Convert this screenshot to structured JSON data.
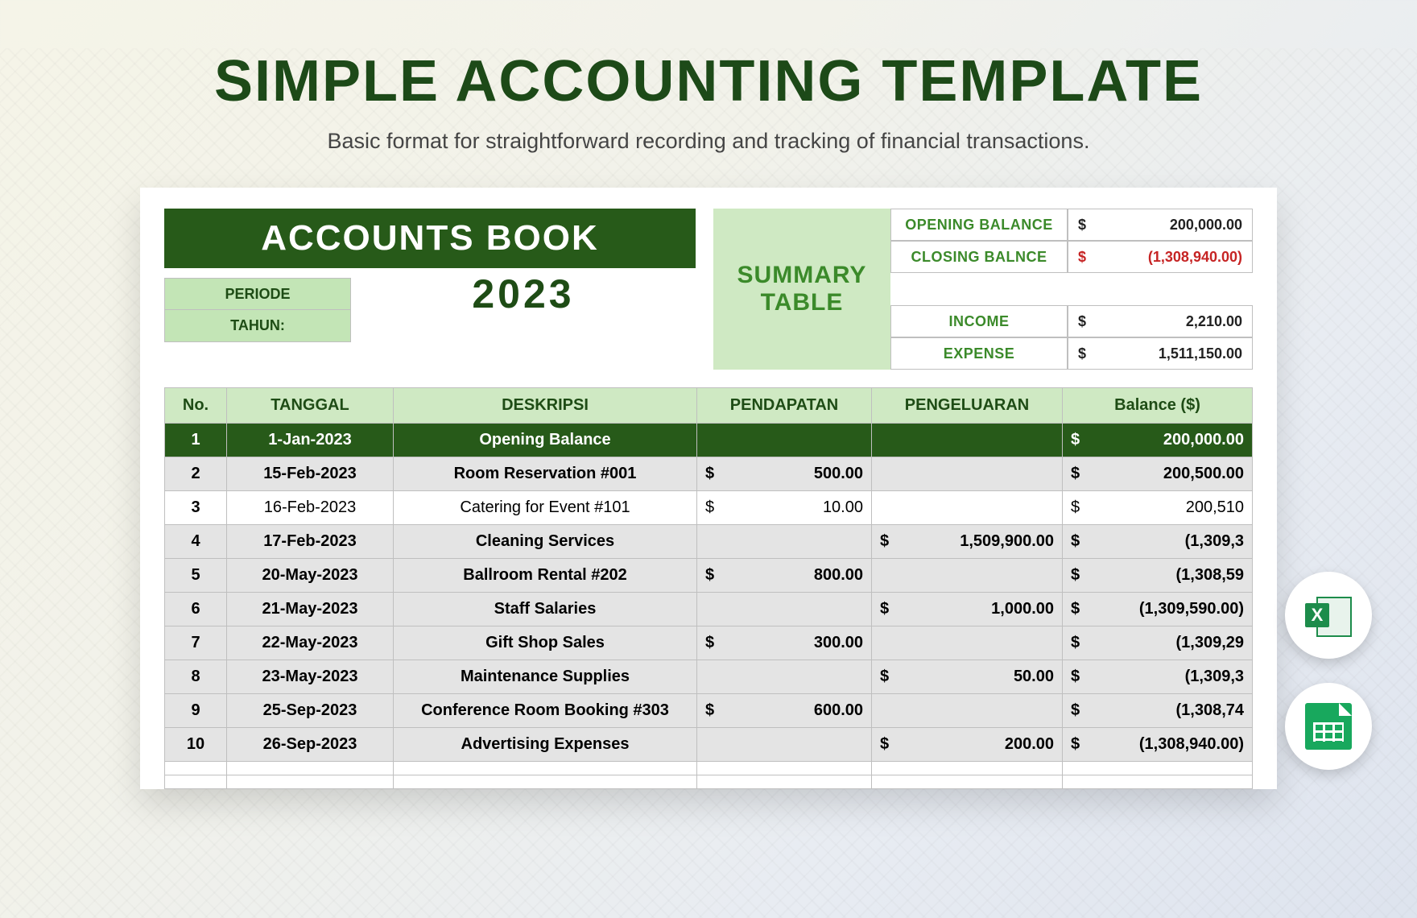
{
  "page": {
    "title": "SIMPLE ACCOUNTING TEMPLATE",
    "subtitle": "Basic format for straightforward recording and tracking of financial transactions."
  },
  "accounts": {
    "title": "ACCOUNTS BOOK",
    "periode_label": "PERIODE",
    "tahun_label": "TAHUN:",
    "year": "2023"
  },
  "summary": {
    "title": "SUMMARY TABLE",
    "rows": [
      {
        "label": "OPENING BALANCE",
        "cur": "$",
        "val": "200,000.00",
        "neg": false
      },
      {
        "label": "CLOSING BALNCE",
        "cur": "$",
        "val": "(1,308,940.00)",
        "neg": true
      },
      {
        "label": "INCOME",
        "cur": "$",
        "val": "2,210.00",
        "neg": false
      },
      {
        "label": "EXPENSE",
        "cur": "$",
        "val": "1,511,150.00",
        "neg": false
      }
    ]
  },
  "columns": {
    "no": "No.",
    "tanggal": "TANGGAL",
    "deskripsi": "DESKRIPSI",
    "pendapatan": "PENDAPATAN",
    "pengeluaran": "PENGELUARAN",
    "balance": "Balance ($)"
  },
  "rows": [
    {
      "no": "1",
      "tanggal": "1-Jan-2023",
      "desk": "Opening Balance",
      "in": "",
      "out": "",
      "bal": "200,000.00",
      "style": "dark"
    },
    {
      "no": "2",
      "tanggal": "15-Feb-2023",
      "desk": "Room Reservation #001",
      "in": "500.00",
      "out": "",
      "bal": "200,500.00",
      "style": "grey"
    },
    {
      "no": "3",
      "tanggal": "16-Feb-2023",
      "desk": "Catering for Event #101",
      "in": "10.00",
      "out": "",
      "bal": "200,510",
      "style": ""
    },
    {
      "no": "4",
      "tanggal": "17-Feb-2023",
      "desk": "Cleaning Services",
      "in": "",
      "out": "1,509,900.00",
      "bal": "(1,309,3",
      "style": "grey"
    },
    {
      "no": "5",
      "tanggal": "20-May-2023",
      "desk": "Ballroom Rental #202",
      "in": "800.00",
      "out": "",
      "bal": "(1,308,59",
      "style": "grey"
    },
    {
      "no": "6",
      "tanggal": "21-May-2023",
      "desk": "Staff Salaries",
      "in": "",
      "out": "1,000.00",
      "bal": "(1,309,590.00)",
      "style": "grey"
    },
    {
      "no": "7",
      "tanggal": "22-May-2023",
      "desk": "Gift Shop Sales",
      "in": "300.00",
      "out": "",
      "bal": "(1,309,29",
      "style": "grey"
    },
    {
      "no": "8",
      "tanggal": "23-May-2023",
      "desk": "Maintenance Supplies",
      "in": "",
      "out": "50.00",
      "bal": "(1,309,3",
      "style": "grey"
    },
    {
      "no": "9",
      "tanggal": "25-Sep-2023",
      "desk": "Conference Room Booking #303",
      "in": "600.00",
      "out": "",
      "bal": "(1,308,74",
      "style": "grey"
    },
    {
      "no": "10",
      "tanggal": "26-Sep-2023",
      "desk": "Advertising Expenses",
      "in": "",
      "out": "200.00",
      "bal": "(1,308,940.00)",
      "style": "grey"
    },
    {
      "no": "",
      "tanggal": "",
      "desk": "",
      "in": "",
      "out": "",
      "bal": "",
      "style": ""
    },
    {
      "no": "",
      "tanggal": "",
      "desk": "",
      "in": "",
      "out": "",
      "bal": "",
      "style": ""
    }
  ],
  "cur": "$",
  "badges": {
    "excel": "X"
  }
}
